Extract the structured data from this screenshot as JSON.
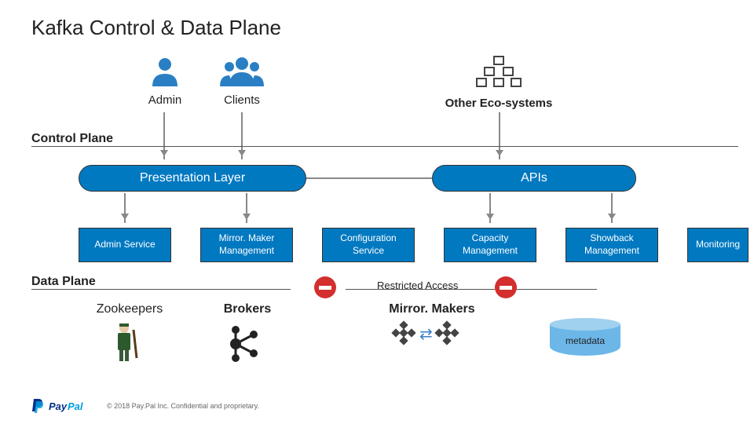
{
  "title": "Kafka Control & Data Plane",
  "actors": {
    "admin": "Admin",
    "clients": "Clients",
    "eco": "Other Eco-systems"
  },
  "sections": {
    "control_plane": "Control Plane",
    "data_plane": "Data Plane"
  },
  "layers": {
    "presentation": "Presentation Layer",
    "apis": "APIs"
  },
  "services": {
    "admin_service": "Admin Service",
    "mm_mgmt": "Mirror. Maker Management",
    "config_service": "Configuration Service",
    "capacity_mgmt": "Capacity Management",
    "showback_mgmt": "Showback Management",
    "monitoring": "Monitoring"
  },
  "restricted": "Restricted Access",
  "data_plane_items": {
    "zookeepers": "Zookeepers",
    "brokers": "Brokers",
    "mirrormakers": "Mirror. Makers",
    "metadata": "metadata"
  },
  "footer": {
    "brand": "PayPal",
    "copyright": "© 2018 Pay.Pal Inc. Confidential and proprietary."
  },
  "colors": {
    "primary_blue": "#0079c1",
    "paypal_dark": "#003087",
    "paypal_light": "#009cde",
    "red": "#d32f2f",
    "cylinder": "#6db7e8"
  }
}
